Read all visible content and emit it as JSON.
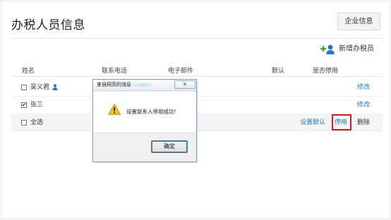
{
  "page": {
    "title": "办税人员信息",
    "company_info_button": "企业信息",
    "add_button": "新增办税员"
  },
  "table": {
    "columns": [
      "姓名",
      "联系电话",
      "电子邮件",
      "默认",
      "是否停用"
    ],
    "rows": [
      {
        "name": "吴义君",
        "checked": false,
        "action": "修改"
      },
      {
        "name": "张三",
        "checked": true,
        "action": "修改"
      }
    ],
    "footer": {
      "select_all": "全选",
      "set_default": "设置默认",
      "disable": "停用",
      "delete": "删除"
    }
  },
  "dialog": {
    "title": "来自网页的消息",
    "close_glyph": "✕",
    "message": "设置联系人停用成功!",
    "ok_button": "确定"
  },
  "colors": {
    "link": "#1f77c8",
    "highlight_border": "#e0161b",
    "add_icon_green": "#3aa63a",
    "add_icon_blue": "#1f77c8"
  },
  "icons": {
    "add_user": "add-user-icon",
    "user": "user-icon",
    "warning": "warning-icon",
    "close": "close-icon"
  }
}
